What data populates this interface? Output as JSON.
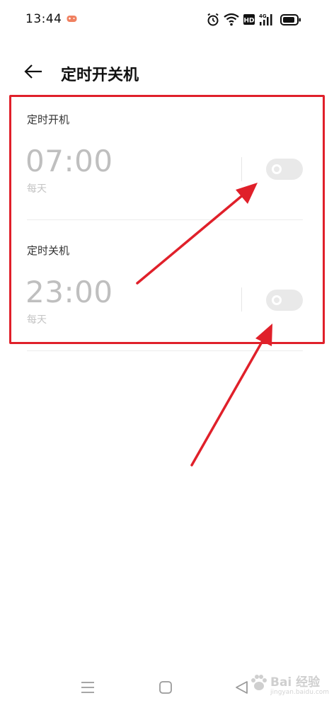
{
  "status_bar": {
    "time": "13:44"
  },
  "header": {
    "title": "定时开关机"
  },
  "schedules": [
    {
      "section_label": "定时开机",
      "time": "07:00",
      "repeat": "每天",
      "enabled": false
    },
    {
      "section_label": "定时关机",
      "time": "23:00",
      "repeat": "每天",
      "enabled": false
    }
  ],
  "colors": {
    "annotation": "#e0202a",
    "disabled_text": "#bfbfbf",
    "toggle_off": "#e9e9e9"
  },
  "watermark": {
    "text": "Bai 经验",
    "sub": "jingyan.baidu.com"
  }
}
